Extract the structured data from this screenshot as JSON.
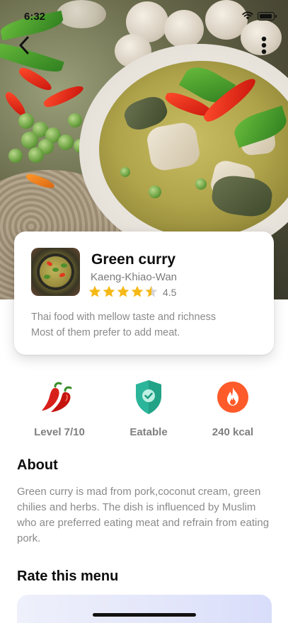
{
  "status_bar": {
    "time": "6:32"
  },
  "hero": {
    "image": "green-curry-photo"
  },
  "nav": {
    "back_icon": "chevron-left-icon",
    "more_icon": "more-vertical-icon"
  },
  "dish": {
    "name": "Green curry",
    "local_name": "Kaeng-Khiao-Wan",
    "rating": "4.5",
    "rating_value": 4.5,
    "rating_max": 5,
    "description_line1": "Thai food with mellow taste and richness",
    "description_line2": "Most of them prefer to add meat."
  },
  "features": [
    {
      "icon": "chili-icon",
      "label": "Level 7/10"
    },
    {
      "icon": "shield-check-icon",
      "label": "Eatable"
    },
    {
      "icon": "fire-icon",
      "label": "240 kcal"
    }
  ],
  "about": {
    "title": "About",
    "text": "Green  curry is mad from pork,coconut cream, green chilies and herbs. The dish is influenced by Muslim who are preferred eating meat and refrain from eating pork."
  },
  "rate": {
    "title": "Rate this menu"
  },
  "colors": {
    "star": "#f5b816",
    "shield": "#2bb59a",
    "fire": "#ff5a2a",
    "chili": "#d8201a"
  }
}
